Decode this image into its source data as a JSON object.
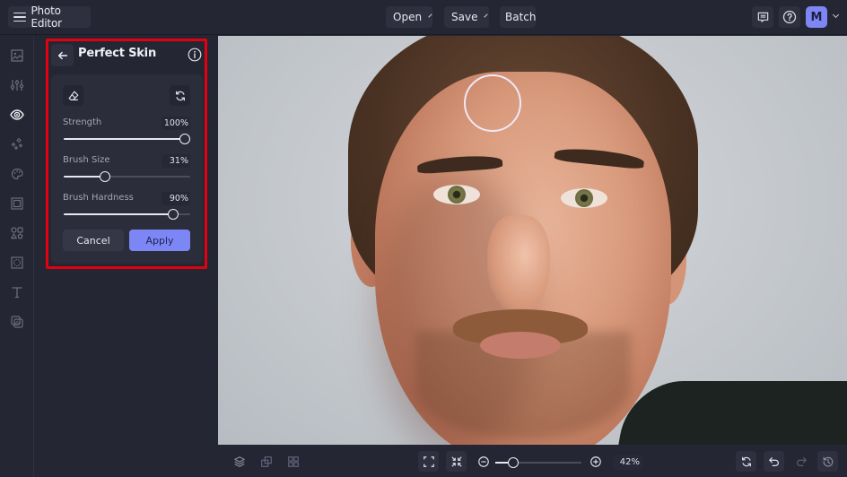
{
  "topbar": {
    "app_title": "Photo Editor",
    "menu_icon": "hamburger-menu-icon",
    "open_label": "Open",
    "save_label": "Save",
    "batch_label": "Batch",
    "feedback_icon": "comment-icon",
    "help_icon": "question-circle-icon",
    "avatar_initial": "M",
    "avatar_color": "#7d86f3"
  },
  "rail": {
    "items": [
      {
        "name": "image",
        "icon": "image-icon",
        "active": false
      },
      {
        "name": "adjust",
        "icon": "sliders-icon",
        "active": false
      },
      {
        "name": "touch-up",
        "icon": "eye-icon",
        "active": true
      },
      {
        "name": "effects",
        "icon": "sparkle-icon",
        "active": false
      },
      {
        "name": "artsy",
        "icon": "palette-icon",
        "active": false
      },
      {
        "name": "frames",
        "icon": "frame-icon",
        "active": false
      },
      {
        "name": "graphics",
        "icon": "shapes-icon",
        "active": false
      },
      {
        "name": "textures",
        "icon": "texture-icon",
        "active": false
      },
      {
        "name": "text",
        "icon": "text-icon",
        "active": false
      },
      {
        "name": "overlays",
        "icon": "overlay-icon",
        "active": false
      }
    ]
  },
  "panel": {
    "title": "Perfect Skin",
    "back_icon": "arrow-left-icon",
    "info_icon": "info-icon",
    "eraser_icon": "eraser-icon",
    "reset_icon": "refresh-icon",
    "sliders": [
      {
        "label": "Strength",
        "value_text": "100%",
        "value": 100
      },
      {
        "label": "Brush Size",
        "value_text": "31%",
        "value": 31
      },
      {
        "label": "Brush Hardness",
        "value_text": "90%",
        "value": 90
      }
    ],
    "cancel_label": "Cancel",
    "apply_label": "Apply",
    "highlight_color": "#e3000f",
    "accent_color": "#7d86f5"
  },
  "bottombar": {
    "left_icons": [
      "layers-icon",
      "arrange-icon",
      "grid-icon"
    ],
    "fit_icon": "fit-screen-icon",
    "actual_size_icon": "shrink-icon",
    "zoom_out_icon": "zoom-out-icon",
    "zoom_in_icon": "zoom-in-icon",
    "zoom_value": 42,
    "zoom_text": "42%",
    "right_icons": [
      "compare-icon",
      "undo-icon",
      "redo-icon",
      "history-icon"
    ]
  }
}
